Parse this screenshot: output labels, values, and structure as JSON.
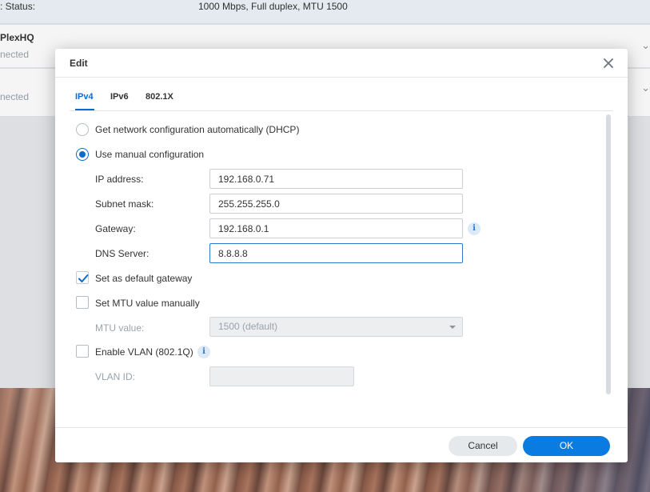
{
  "background": {
    "status_label": ": Status:",
    "status_value": "1000 Mbps, Full duplex, MTU 1500",
    "row1_title": "PlexHQ",
    "row1_sub": "nected",
    "row2_sub": "nected",
    "chevron_icon": "chevron-down-icon"
  },
  "dialog": {
    "title": "Edit",
    "close_icon": "close-icon",
    "tabs": [
      {
        "label": "IPv4",
        "active": true
      },
      {
        "label": "IPv6",
        "active": false
      },
      {
        "label": "802.1X",
        "active": false
      }
    ],
    "dhcp_option": {
      "label": "Get network configuration automatically (DHCP)",
      "checked": false
    },
    "manual_option": {
      "label": "Use manual configuration",
      "checked": true
    },
    "ip_address": {
      "label": "IP address:",
      "value": "192.168.0.71"
    },
    "subnet_mask": {
      "label": "Subnet mask:",
      "value": "255.255.255.0"
    },
    "gateway": {
      "label": "Gateway:",
      "value": "192.168.0.1"
    },
    "dns_server": {
      "label": "DNS Server:",
      "value": "8.8.8.8"
    },
    "default_gateway": {
      "label": "Set as default gateway",
      "checked": true
    },
    "set_mtu": {
      "label": "Set MTU value manually",
      "checked": false
    },
    "mtu_value": {
      "label": "MTU value:",
      "value": "1500 (default)"
    },
    "enable_vlan": {
      "label": "Enable VLAN (802.1Q)",
      "checked": false
    },
    "vlan_id": {
      "label": "VLAN ID:",
      "value": ""
    },
    "info_glyph": "i",
    "cancel_label": "Cancel",
    "ok_label": "OK"
  },
  "colors": {
    "accent": "#0c6bcf",
    "ok_button": "#0a7be0",
    "cancel_button": "#e6e9ec"
  }
}
